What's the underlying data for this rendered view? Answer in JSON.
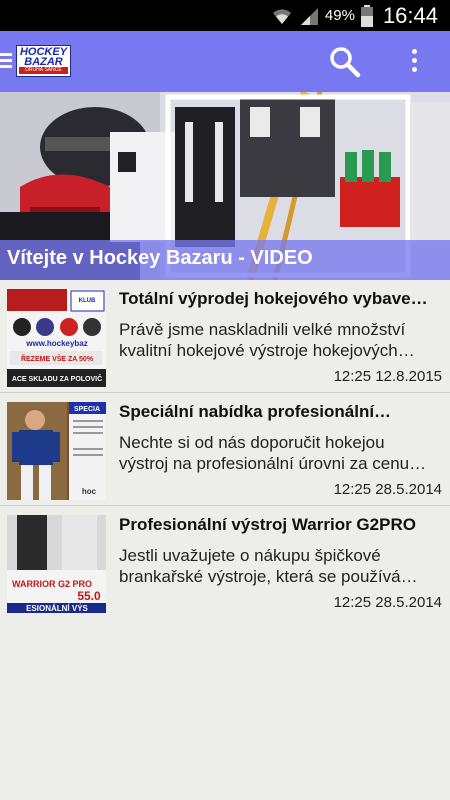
{
  "status_bar": {
    "battery_percent": "49%",
    "time": "16:44",
    "icons": [
      "wifi-icon",
      "signal-icon",
      "battery-icon"
    ]
  },
  "app_bar": {
    "logo_line1": "HOCKEY",
    "logo_line2": "BAZAR",
    "logo_line3": "DRUHÁ ŠANCE",
    "accent_color": "#7878f0",
    "icons": [
      "menu-icon",
      "search-icon",
      "more-vert-icon"
    ]
  },
  "hero": {
    "caption": "Vítejte v Hockey Bazaru - VIDEO"
  },
  "articles": [
    {
      "title": "Totální výprodej hokejového vybavení…",
      "description": "Právě jsme naskladnili velké množství kvalitní hokejové výstroje hokejových…",
      "date": "12:25 12.8.2015",
      "thumb_text_top": "KLUB",
      "thumb_text_mid": "www.hockeybaz",
      "thumb_text_red": "ŘEZEME VŠE ZA 50%",
      "thumb_text_bottom": "ACE SKLADU ZA POLOVIČ"
    },
    {
      "title": "Speciální nabídka profesionální…",
      "description": "Nechte si od nás doporučit hokejou výstroj na profesionální úrovni za cenu…",
      "date": "12:25 28.5.2014",
      "thumb_text_top": "SPECIA",
      "thumb_text_bottom": "hoc"
    },
    {
      "title": "Profesionální výstroj Warrior G2PRO",
      "description": "Jestli uvažujete o nákupu špičkové brankařské výstroje, která se používá…",
      "date": "12:25 28.5.2014",
      "thumb_text_top": "WARRIOR G2 PRO",
      "thumb_text_price": "55.0",
      "thumb_text_bottom": "ESIONÁLNÍ VÝS"
    }
  ]
}
